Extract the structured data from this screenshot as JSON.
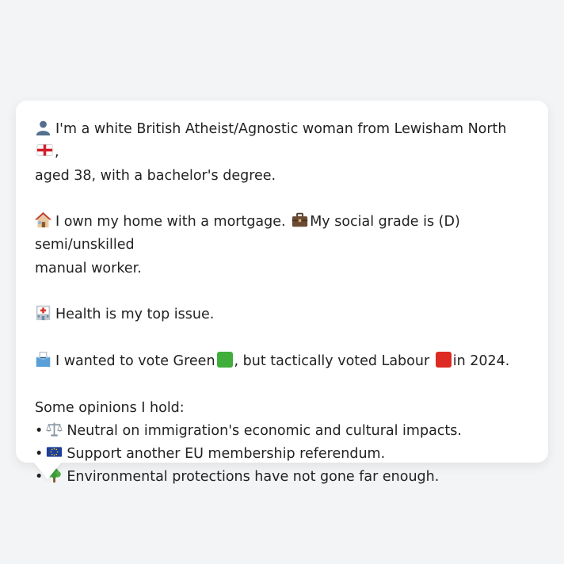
{
  "profile": {
    "intro_line1": "I'm a white British Atheist/Agnostic woman from Lewisham North",
    "intro_line1_end": ",",
    "intro_line2": "aged 38, with a bachelor's degree.",
    "home_text": "I own my home with a mortgage.",
    "grade_line1": "My social grade is (D) semi/unskilled",
    "grade_line2": "manual worker.",
    "health_text": "Health is my top issue.",
    "vote_part1": "I wanted to vote Green",
    "vote_part2": ", but tactically voted Labour",
    "vote_part3": "in 2024.",
    "opinions_header": "Some opinions I hold:",
    "bullet": "•",
    "opinions": [
      "Neutral on immigration's economic and cultural impacts.",
      "Support another EU membership referendum.",
      "Environmental protections have not gone far enough."
    ]
  },
  "icons": {
    "person": "person-silhouette-icon",
    "flag": "england-flag-icon",
    "home": "house-icon",
    "briefcase": "briefcase-icon",
    "hospital": "hospital-icon",
    "ballot": "ballot-box-icon",
    "scales": "balance-scale-icon",
    "eu": "eu-flag-icon",
    "tree": "tree-icon"
  },
  "colors": {
    "green_party": "#3fae3a",
    "labour_party": "#dd2a22",
    "text": "#222222",
    "background": "#f3f4f6",
    "card": "#ffffff"
  }
}
